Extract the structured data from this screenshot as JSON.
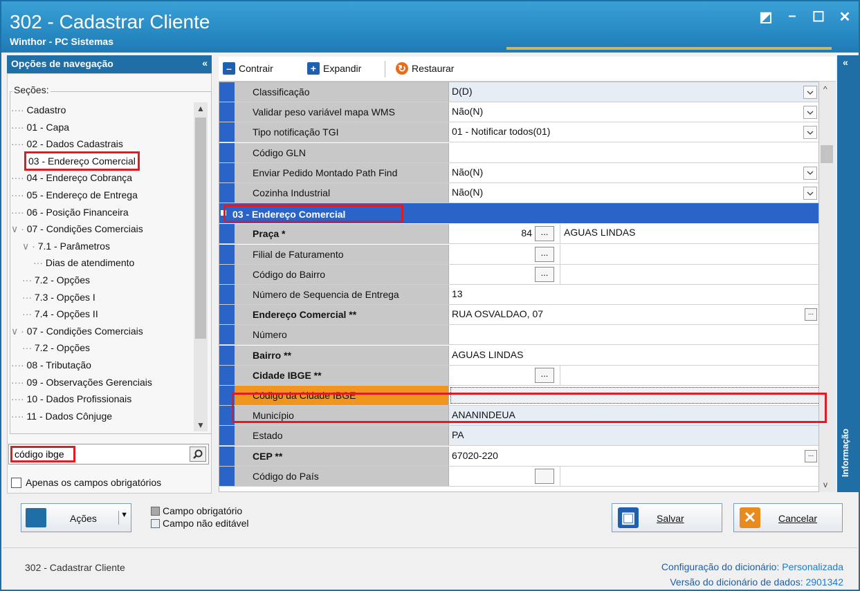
{
  "window": {
    "title": "302 - Cadastrar Cliente",
    "subtitle": "Winthor - PC Sistemas",
    "controls": [
      "◩",
      "–",
      "☐",
      "✕"
    ]
  },
  "nav": {
    "header": "Opções de navegação",
    "collapse": "«",
    "sections_label": "Seções:",
    "tree": [
      {
        "label": "Cadastro",
        "level": 0,
        "prefix": "····"
      },
      {
        "label": "01 - Capa",
        "level": 0,
        "prefix": "····"
      },
      {
        "label": "02 - Dados Cadastrais",
        "level": 0,
        "prefix": "····"
      },
      {
        "label": "03 - Endereço Comercial",
        "level": 0,
        "prefix": "····",
        "selected": true
      },
      {
        "label": "04 - Endereço Cobrança",
        "level": 0,
        "prefix": "····"
      },
      {
        "label": "05 - Endereço de Entrega",
        "level": 0,
        "prefix": "····"
      },
      {
        "label": "06 - Posição Financeira",
        "level": 0,
        "prefix": "····"
      },
      {
        "label": "07 - Condições Comerciais",
        "level": 0,
        "prefix": "∨ ·"
      },
      {
        "label": "7.1 - Parâmetros",
        "level": 1,
        "prefix": "∨ ·"
      },
      {
        "label": "Dias de atendimento",
        "level": 2,
        "prefix": "···"
      },
      {
        "label": "7.2 - Opções",
        "level": 1,
        "prefix": "···"
      },
      {
        "label": "7.3 - Opções I",
        "level": 1,
        "prefix": "···"
      },
      {
        "label": "7.4 - Opções II",
        "level": 1,
        "prefix": "···"
      },
      {
        "label": "07 - Condições Comerciais",
        "level": 0,
        "prefix": "∨ ·"
      },
      {
        "label": "7.2 - Opções",
        "level": 1,
        "prefix": "···"
      },
      {
        "label": "08 - Tributação",
        "level": 0,
        "prefix": "····"
      },
      {
        "label": "09 - Observações Gerenciais",
        "level": 0,
        "prefix": "····"
      },
      {
        "label": "10 - Dados Profissionais",
        "level": 0,
        "prefix": "····"
      },
      {
        "label": "11 - Dados Cônjuge",
        "level": 0,
        "prefix": "····"
      }
    ],
    "search_value": "código ibge",
    "only_required_label": "Apenas os campos obrigatórios"
  },
  "toolbar": {
    "collapse": "Contrair",
    "expand": "Expandir",
    "restore": "Restaurar"
  },
  "grid": {
    "rows_top": [
      {
        "label": "Classificação",
        "value": "D(D)",
        "dropdown": true,
        "ro": true
      },
      {
        "label": "Validar peso variável mapa WMS",
        "value": "Não(N)",
        "dropdown": true
      },
      {
        "label": "Tipo notificação TGI",
        "value": "01 - Notificar todos(01)",
        "dropdown": true
      },
      {
        "label": "Código GLN",
        "value": ""
      },
      {
        "label": "Enviar Pedido Montado Path Find",
        "value": "Não(N)",
        "dropdown": true
      },
      {
        "label": "Cozinha Industrial",
        "value": "Não(N)",
        "dropdown": true
      }
    ],
    "section_title": "03 - Endereço Comercial",
    "rows_section": [
      {
        "label": "Praça *",
        "bold": true,
        "code": "84",
        "ellipsis": "...",
        "text": "AGUAS LINDAS"
      },
      {
        "label": "Filial de Faturamento",
        "code": "",
        "ellipsis": "...",
        "text": ""
      },
      {
        "label": "Código do Bairro",
        "code": "",
        "ellipsis": "...",
        "text": ""
      },
      {
        "label": "Número de Sequencia de Entrega",
        "value": "13"
      },
      {
        "label": "Endereço Comercial **",
        "bold": true,
        "value": "RUA OSVALDAO, 07",
        "small_ellipsis": "..."
      },
      {
        "label": "Número",
        "value": ""
      },
      {
        "label": "Bairro **",
        "bold": true,
        "value": "AGUAS LINDAS"
      },
      {
        "label": "Cidade IBGE **",
        "bold": true,
        "code": "",
        "ellipsis": "...",
        "text": ""
      },
      {
        "label": "Código da Cidade IBGE",
        "value": "",
        "highlight": true
      },
      {
        "label": "Município",
        "value": "ANANINDEUA",
        "ro": true
      },
      {
        "label": "Estado",
        "value": "PA",
        "ro": true
      },
      {
        "label": "CEP **",
        "bold": true,
        "value": "67020-220",
        "small_ellipsis": "..."
      },
      {
        "label": "Código do País",
        "code": "",
        "ellipsis": "",
        "text": ""
      }
    ]
  },
  "info_panel": {
    "collapse": "«",
    "label": "Informação"
  },
  "bottom": {
    "actions": "Ações",
    "legend_required": "Campo obrigatório",
    "legend_readonly": "Campo não editável",
    "save": "Salvar",
    "cancel": "Cancelar"
  },
  "status": {
    "left": "302 - Cadastrar Cliente",
    "dict_config_label": "Configuração do dicionário:",
    "dict_config_value": "Personalizada",
    "dict_version_label": "Versão do dicionário de dados:",
    "dict_version_value": "2901342"
  },
  "colors": {
    "title_bar": "#2a8cc5",
    "nav_header": "#1f6ea6",
    "section_blue": "#2b64c8",
    "highlight_orange": "#f0961e",
    "annotation_red": "#e01b24"
  }
}
